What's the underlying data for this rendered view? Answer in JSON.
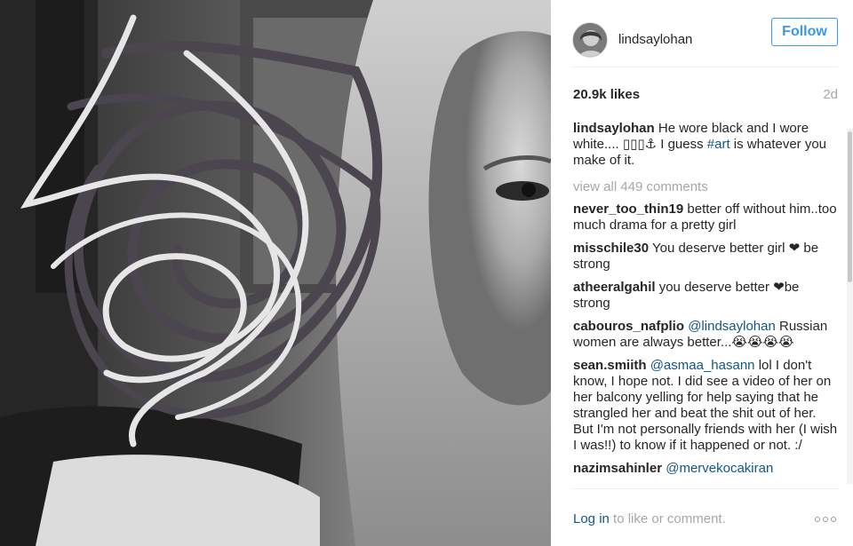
{
  "post": {
    "username": "lindsaylohan",
    "follow_label": "Follow",
    "likes": "20.9k likes",
    "time": "2d"
  },
  "caption": {
    "username": "lindsaylohan",
    "text_before": "He wore black and I wore white.... ",
    "emoji_text": "▯▯▯⚓",
    "text_mid": " I guess ",
    "hashtag": "#art",
    "text_after": " is whatever you make of it."
  },
  "view_all": "view all 449 comments",
  "comments": [
    {
      "user": "never_too_thin19",
      "mention": "",
      "text": "better off without him..too much drama for a pretty girl"
    },
    {
      "user": "misschile30",
      "mention": "",
      "text": "You deserve better girl ❤ be strong"
    },
    {
      "user": "atheeralgahil",
      "mention": "",
      "text": "you deserve better ❤be strong"
    },
    {
      "user": "cabouros_nafplio",
      "mention": "@lindsaylohan",
      "text": "Russian women are always better...😭😭😭😭"
    },
    {
      "user": "sean.smiith",
      "mention": "@asmaa_hasann",
      "text": "lol I don't know, I hope not. I did see a video of her on her balcony yelling for help saying that he strangled her and beat the shit out of her. But I'm not personally friends with her (I wish I was!!) to know if it happened or not. :/"
    },
    {
      "user": "nazimsahinler",
      "mention": "@mervekocakiran",
      "text": ""
    }
  ],
  "footer": {
    "login_link": "Log in",
    "login_rest": " to like or comment."
  },
  "colors": {
    "link": "#125688",
    "follow_blue": "#3897f0",
    "muted": "#a5a7aa"
  },
  "icons": {
    "more": "more-options-icon",
    "avatar": "profile-avatar"
  }
}
